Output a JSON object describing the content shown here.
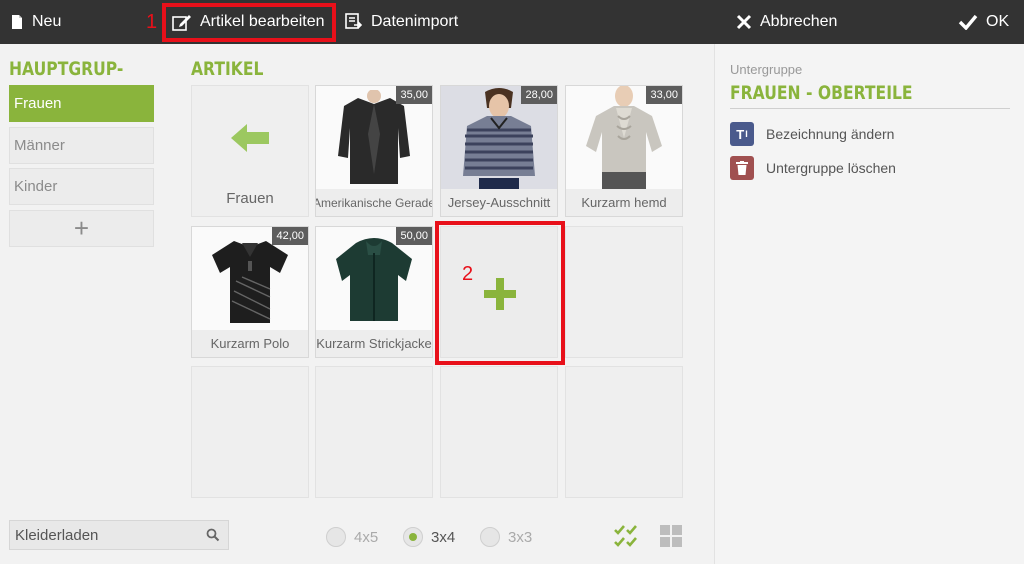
{
  "toolbar": {
    "new_label": "Neu",
    "edit_label": "Artikel bearbeiten",
    "import_label": "Datenimport",
    "cancel_label": "Abbrechen",
    "ok_label": "OK"
  },
  "annotations": {
    "marker_1": "1",
    "marker_2": "2",
    "highlight_color": "#e8101a"
  },
  "groups": {
    "heading": "Hauptgrup-",
    "items": [
      {
        "label": "Frauen",
        "active": true
      },
      {
        "label": "Männer",
        "active": false
      },
      {
        "label": "Kinder",
        "active": false
      }
    ],
    "add_label": "+"
  },
  "articles": {
    "heading": "Artikel",
    "back_label": "Frauen",
    "items": [
      {
        "name": "Amerikanische Gerade",
        "price": "35,00",
        "icon": "jacket-image"
      },
      {
        "name": "Jersey-Ausschnitt",
        "price": "28,00",
        "icon": "striped-top-image"
      },
      {
        "name": "Kurzarm hemd",
        "price": "33,00",
        "icon": "blouse-image"
      },
      {
        "name": "Kurzarm Polo",
        "price": "42,00",
        "icon": "polo-shirt-image"
      },
      {
        "name": "Kurzarm Strickjacke",
        "price": "50,00",
        "icon": "knit-cardigan-image"
      }
    ]
  },
  "search": {
    "value": "Kleiderladen",
    "icon": "search-icon"
  },
  "grid_size": {
    "options": [
      {
        "label": "4x5",
        "selected": false
      },
      {
        "label": "3x4",
        "selected": true
      },
      {
        "label": "3x3",
        "selected": false
      }
    ]
  },
  "subgroup": {
    "label": "Untergruppe",
    "title": "Frauen - Oberteile",
    "rename_label": "Bezeichnung ändern",
    "delete_label": "Untergruppe löschen"
  },
  "colors": {
    "accent": "#8ab43c",
    "toolbar": "#333333",
    "rename_icon": "#4a5a8c",
    "delete_icon": "#a05050"
  }
}
